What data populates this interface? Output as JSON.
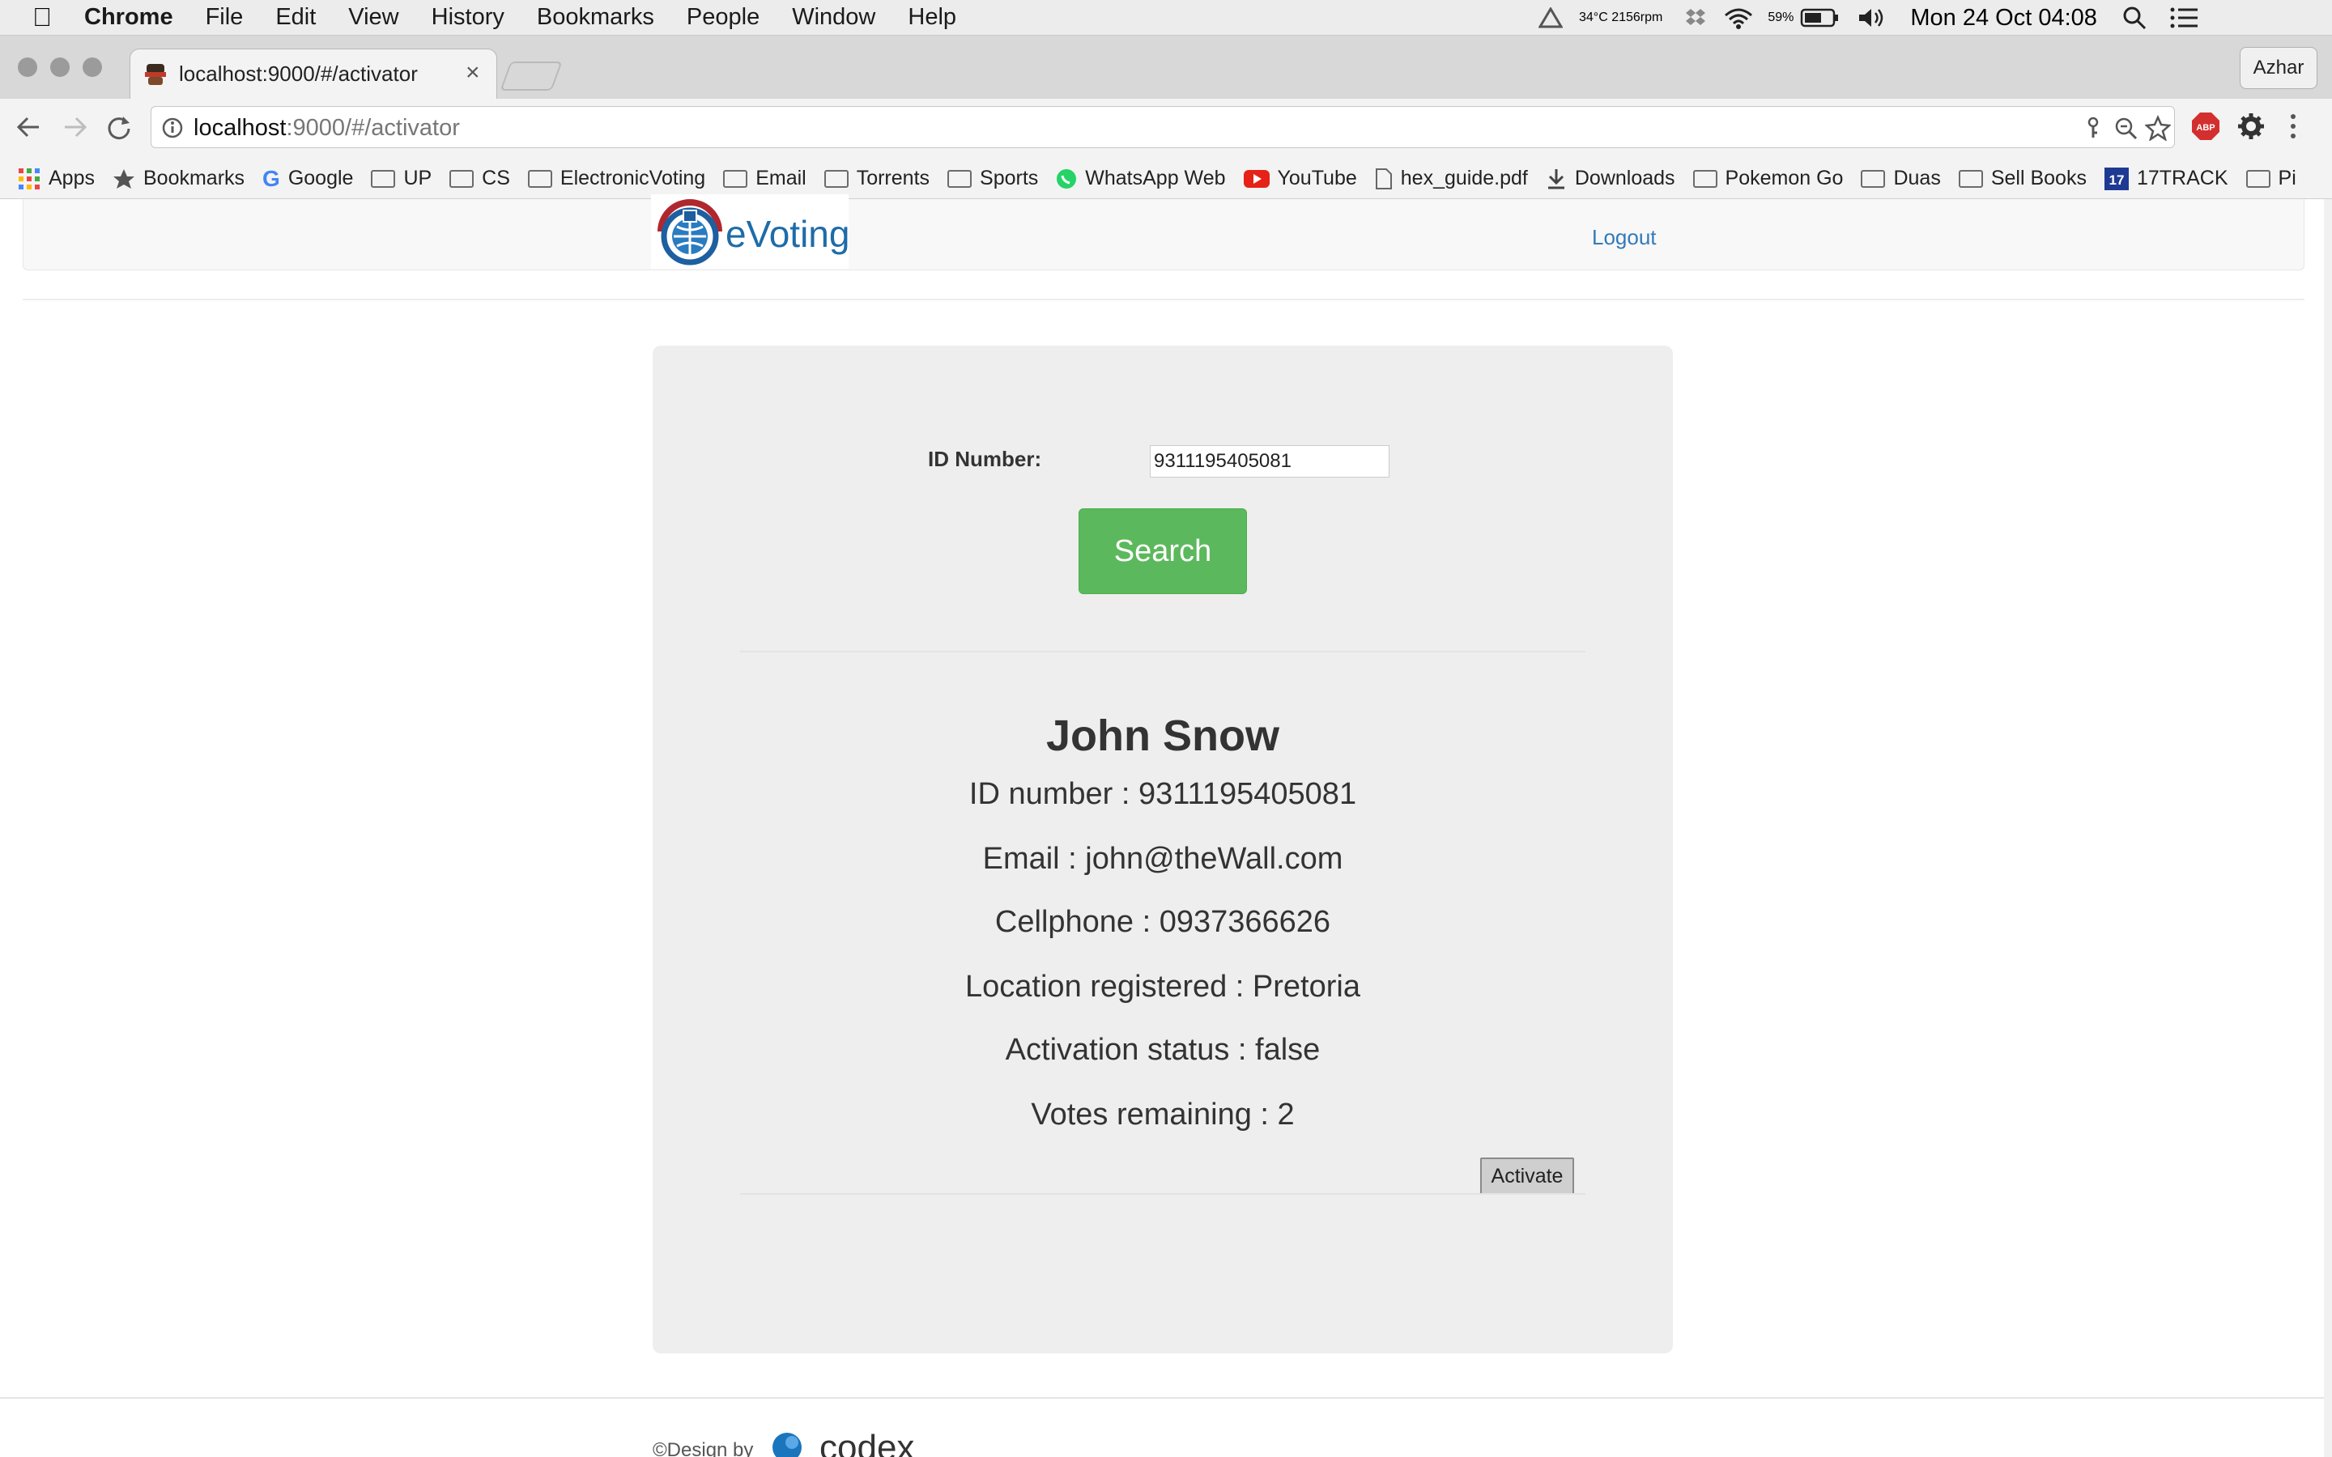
{
  "menubar": {
    "app": "Chrome",
    "items": [
      "File",
      "Edit",
      "View",
      "History",
      "Bookmarks",
      "People",
      "Window",
      "Help"
    ],
    "status_temp": "34°C 2156rpm",
    "battery": "59%",
    "datetime": "Mon 24 Oct  04:08"
  },
  "browser": {
    "tab_title": "localhost:9000/#/activator",
    "profile": "Azhar",
    "url_host": "localhost",
    "url_path": ":9000/#/activator"
  },
  "bookmarks": [
    {
      "label": "Apps",
      "icon": "apps-grid-icon"
    },
    {
      "label": "Bookmarks",
      "icon": "star-icon"
    },
    {
      "label": "Google",
      "icon": "google-icon"
    },
    {
      "label": "UP",
      "icon": "folder-icon"
    },
    {
      "label": "CS",
      "icon": "folder-icon"
    },
    {
      "label": "ElectronicVoting",
      "icon": "folder-icon"
    },
    {
      "label": "Email",
      "icon": "folder-icon"
    },
    {
      "label": "Torrents",
      "icon": "folder-icon"
    },
    {
      "label": "Sports",
      "icon": "folder-icon"
    },
    {
      "label": "WhatsApp Web",
      "icon": "whatsapp-icon"
    },
    {
      "label": "YouTube",
      "icon": "youtube-icon"
    },
    {
      "label": "hex_guide.pdf",
      "icon": "file-icon"
    },
    {
      "label": "Downloads",
      "icon": "download-icon"
    },
    {
      "label": "Pokemon Go",
      "icon": "folder-icon"
    },
    {
      "label": "Duas",
      "icon": "folder-icon"
    },
    {
      "label": "Sell Books",
      "icon": "folder-icon"
    },
    {
      "label": "17TRACK",
      "icon": "17track-icon"
    },
    {
      "label": "Pi",
      "icon": "folder-icon"
    }
  ],
  "nav": {
    "brand": "eVoting",
    "logout": "Logout"
  },
  "search": {
    "id_label": "ID Number:",
    "id_value": "9311195405081",
    "button": "Search"
  },
  "voter": {
    "name": "John Snow",
    "id_line": "ID number : 9311195405081",
    "email_line": "Email : john@theWall.com",
    "cell_line": "Cellphone : 0937366626",
    "location_line": "Location registered : Pretoria",
    "status_line": "Activation status : false",
    "votes_line": "Votes remaining : 2",
    "activate_button": "Activate"
  },
  "footer": {
    "credit": "©Design by",
    "brand": "codex"
  },
  "colors": {
    "search_green": "#5cb85c",
    "link_blue": "#337ab7",
    "card_bg": "#eeeeee"
  }
}
